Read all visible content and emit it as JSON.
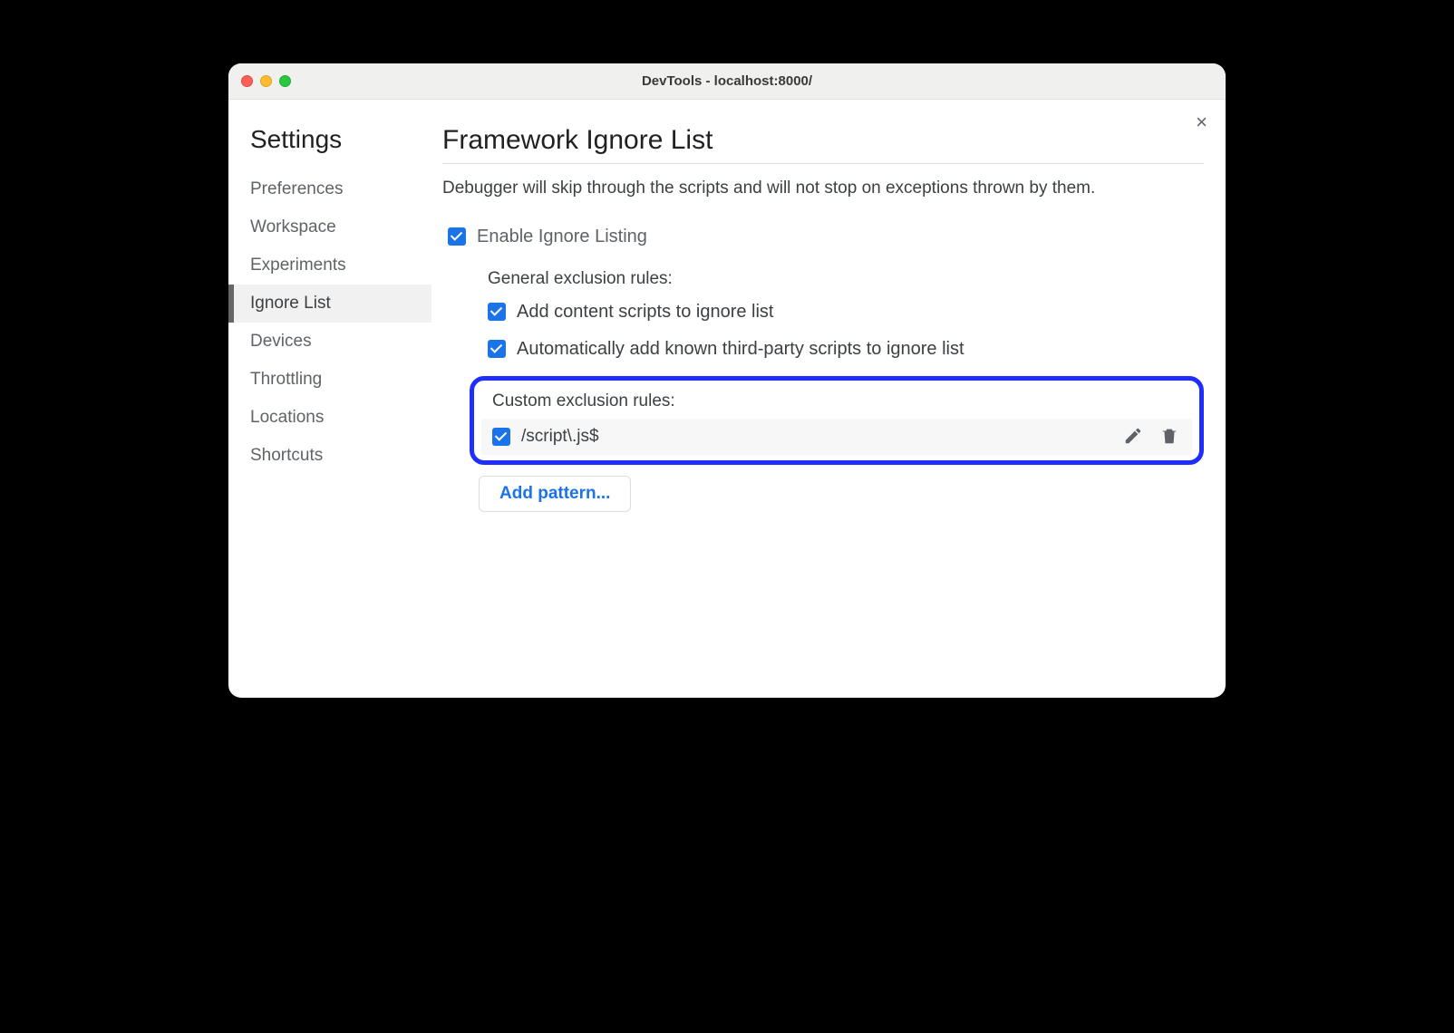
{
  "window": {
    "title": "DevTools - localhost:8000/"
  },
  "close_label": "×",
  "sidebar": {
    "title": "Settings",
    "items": [
      {
        "label": "Preferences",
        "selected": false
      },
      {
        "label": "Workspace",
        "selected": false
      },
      {
        "label": "Experiments",
        "selected": false
      },
      {
        "label": "Ignore List",
        "selected": true
      },
      {
        "label": "Devices",
        "selected": false
      },
      {
        "label": "Throttling",
        "selected": false
      },
      {
        "label": "Locations",
        "selected": false
      },
      {
        "label": "Shortcuts",
        "selected": false
      }
    ]
  },
  "main": {
    "heading": "Framework Ignore List",
    "description": "Debugger will skip through the scripts and will not stop on exceptions thrown by them.",
    "enable": {
      "label": "Enable Ignore Listing",
      "checked": true
    },
    "general_heading": "General exclusion rules:",
    "general_rules": [
      {
        "label": "Add content scripts to ignore list",
        "checked": true
      },
      {
        "label": "Automatically add known third-party scripts to ignore list",
        "checked": true
      }
    ],
    "custom_heading": "Custom exclusion rules:",
    "custom_rules": [
      {
        "pattern": "/script\\.js$",
        "checked": true
      }
    ],
    "add_pattern_label": "Add pattern..."
  }
}
